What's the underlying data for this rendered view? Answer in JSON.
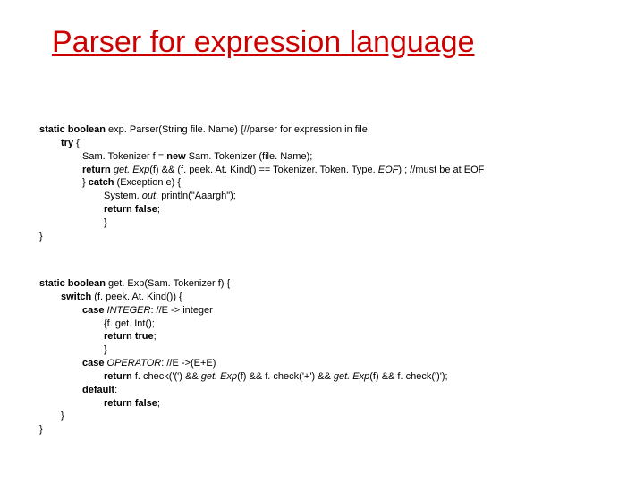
{
  "title": "Parser for expression language",
  "code1": {
    "l1a": "static boolean ",
    "l1b": "exp. Parser(String file. Name) {//parser for expression in file",
    "l2a": "try ",
    "l2b": "{",
    "l3a": "Sam. Tokenizer f = ",
    "l3b": "new ",
    "l3c": "Sam. Tokenizer (file. Name);",
    "l4a": "return ",
    "l4b": "get. Exp",
    "l4c": "(f) && (f. peek. At. Kind() == Tokenizer. Token. Type. ",
    "l4d": "EOF",
    "l4e": ") ; //must be at EOF",
    "l5a": "} ",
    "l5b": "catch ",
    "l5c": "(Exception e) {",
    "l6a": "System. ",
    "l6b": "out",
    "l6c": ". println(\"Aaargh\");",
    "l7a": "return false",
    "l7b": ";",
    "l8": "}",
    "l9": "}"
  },
  "code2": {
    "l1a": "static boolean ",
    "l1b": "get. Exp(Sam. Tokenizer f) {",
    "l2a": "switch ",
    "l2b": "(f. peek. At. Kind()) {",
    "l3a": "case ",
    "l3b": "INTEGER",
    "l3c": ": //E -> integer",
    "l4": "{f. get. Int();",
    "l5a": "return true",
    "l5b": ";",
    "l6": "}",
    "l7a": "case ",
    "l7b": "OPERATOR",
    "l7c": ": //E ->(E+E)",
    "l8a": "return",
    "l8b": "  f. check('(') && ",
    "l8c": "get. Exp",
    "l8d": "(f) && f. check('+') && ",
    "l8e": "get. Exp",
    "l8f": "(f) && f. check(')');",
    "l9a": "default",
    "l9b": ":",
    "l10a": "return false",
    "l10b": ";",
    "l11": "}",
    "l12": "}"
  }
}
